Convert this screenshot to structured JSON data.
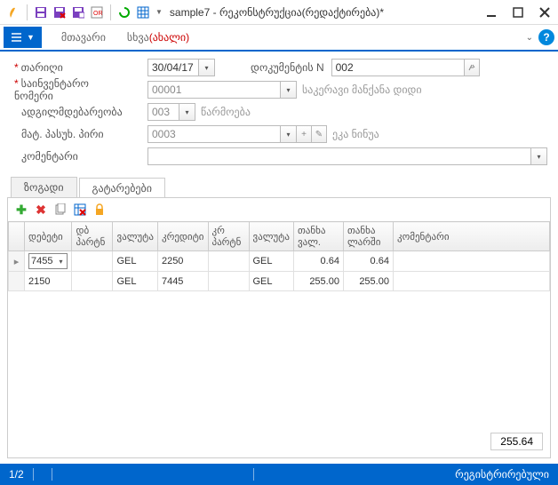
{
  "title": "sample7 - რეკონსტრუქცია(რედაქტირება)*",
  "ribbon": {
    "tab1": "მთავარი",
    "tab2_prefix": "სხვა",
    "tab2_suffix": "(ახალი)"
  },
  "form": {
    "date_label": "თარიღი",
    "date_value": "30/04/17",
    "docnum_label": "დოკუმენტის N",
    "docnum_value": "002",
    "inv_label": "საინვენტარო ნომერი",
    "inv_value": "00001",
    "inv_desc": "საკერავი მანქანა დიდი",
    "loc_label": "ადგილმდებარეობა",
    "loc_value": "003",
    "loc_desc": "წარმოება",
    "resp_label": "მატ. პასუხ. პირი",
    "resp_value": "0003",
    "resp_desc": "ეკა ნინუა",
    "comment_label": "კომენტარი",
    "comment_value": ""
  },
  "tabs": {
    "tab1": "ზოგადი",
    "tab2": "გატარებები"
  },
  "grid": {
    "cols": {
      "debit": "დებეტი",
      "db_part": "დბ პარტნ",
      "currency": "ვალუტა",
      "credit": "კრედიტი",
      "cr_part": "კრ პარტნ",
      "curr2": "ვალუტა",
      "amt_cur": "თანხა ვალ.",
      "amt_gel": "თანხა ლარში",
      "comment": "კომენტარი"
    },
    "rows": [
      {
        "debit": "7455",
        "db_part": "",
        "currency": "GEL",
        "credit": "2250",
        "cr_part": "",
        "curr2": "GEL",
        "amt_cur": "0.64",
        "amt_gel": "0.64",
        "comment": ""
      },
      {
        "debit": "2150",
        "db_part": "",
        "currency": "GEL",
        "credit": "7445",
        "cr_part": "",
        "curr2": "GEL",
        "amt_cur": "255.00",
        "amt_gel": "255.00",
        "comment": ""
      }
    ],
    "total": "255.64"
  },
  "status": {
    "left": "1/2",
    "right": "რეგისტრირებული"
  }
}
